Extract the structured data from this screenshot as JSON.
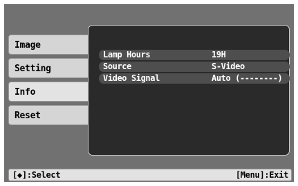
{
  "menu": {
    "items": [
      {
        "label": "Image"
      },
      {
        "label": "Setting"
      },
      {
        "label": "Info"
      },
      {
        "label": "Reset"
      }
    ],
    "selected": "Info"
  },
  "info": {
    "rows": [
      {
        "label": "Lamp Hours",
        "value": "19H"
      },
      {
        "label": "Source",
        "value": "S-Video"
      },
      {
        "label": "Video Signal",
        "value": "Auto (--------)"
      }
    ]
  },
  "statusbar": {
    "left_hint": "[◆]:Select",
    "right_hint": "[Menu]:Exit"
  },
  "colors": {
    "screen_bg": "#717171",
    "panel_bg": "#2a2a2a",
    "menu_bg": "#d5d5d5",
    "row_bg": "#4e4e4e"
  }
}
